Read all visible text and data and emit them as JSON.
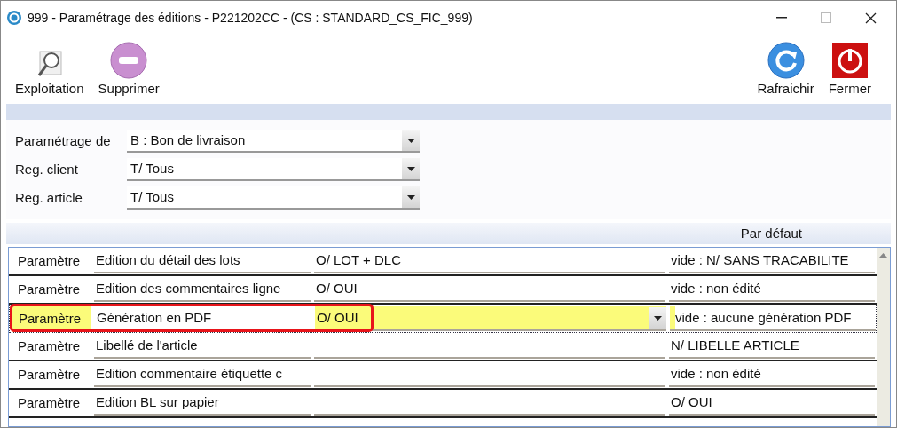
{
  "window": {
    "title": "999 - Paramétrage des éditions - P221202CC - (CS : STANDARD_CS_FIC_999)"
  },
  "toolbar_left": [
    {
      "label": "Exploitation",
      "kind": "search"
    },
    {
      "label": "Supprimer",
      "kind": "remove"
    }
  ],
  "toolbar_right": [
    {
      "label": "Rafraichir",
      "kind": "refresh"
    },
    {
      "label": "Fermer",
      "kind": "power"
    }
  ],
  "filters": [
    {
      "label": "Paramétrage de",
      "value": "B : Bon de livraison"
    },
    {
      "label": "Reg. client",
      "value": "T/ Tous"
    },
    {
      "label": "Reg. article",
      "value": "T/ Tous"
    }
  ],
  "grid": {
    "default_header": "Par défaut",
    "rows": [
      {
        "label": "Paramètre",
        "name": "Edition du détail des lots",
        "value": "O/ LOT + DLC",
        "default": "vide : N/ SANS TRACABILITE",
        "selected": false,
        "callout": false
      },
      {
        "label": "Paramètre",
        "name": "Edition des commentaires ligne",
        "value": "O/ OUI",
        "default": "vide : non édité",
        "selected": false,
        "callout": false
      },
      {
        "label": "Paramètre",
        "name": "Génération en PDF",
        "value": "O/ OUI",
        "default": "vide : aucune génération PDF",
        "selected": true,
        "callout": true
      },
      {
        "label": "Paramètre",
        "name": "Libellé de l'article",
        "default": "N/ LIBELLE ARTICLE",
        "selected": false,
        "callout": false
      },
      {
        "label": "Paramètre",
        "name": "Edition commentaire étiquette c",
        "default": "vide : non édité",
        "selected": false,
        "callout": false
      },
      {
        "label": "Paramètre",
        "name": "Edition BL sur papier",
        "default": "O/ OUI",
        "selected": false,
        "callout": false
      }
    ]
  }
}
